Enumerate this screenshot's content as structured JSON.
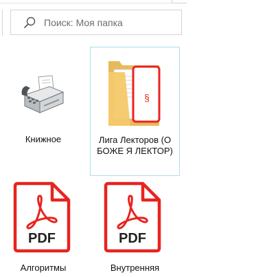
{
  "search": {
    "placeholder": "Поиск: Моя папка"
  },
  "items": [
    {
      "name": "Книжное",
      "type": "printer",
      "selected": false
    },
    {
      "name": "Лига Лекторов (О БОЖЕ Я ЛЕКТОР)",
      "type": "folder",
      "selected": true
    },
    {
      "name": "Алгоритмы",
      "type": "pdf",
      "badge": "PDF",
      "selected": false
    },
    {
      "name": "Внутренняя",
      "type": "pdf",
      "badge": "PDF",
      "selected": false
    }
  ],
  "colors": {
    "pdf_red": "#e8231f",
    "folder_yellow": "#f5c96a",
    "selection_border": "#a9dfe6"
  }
}
